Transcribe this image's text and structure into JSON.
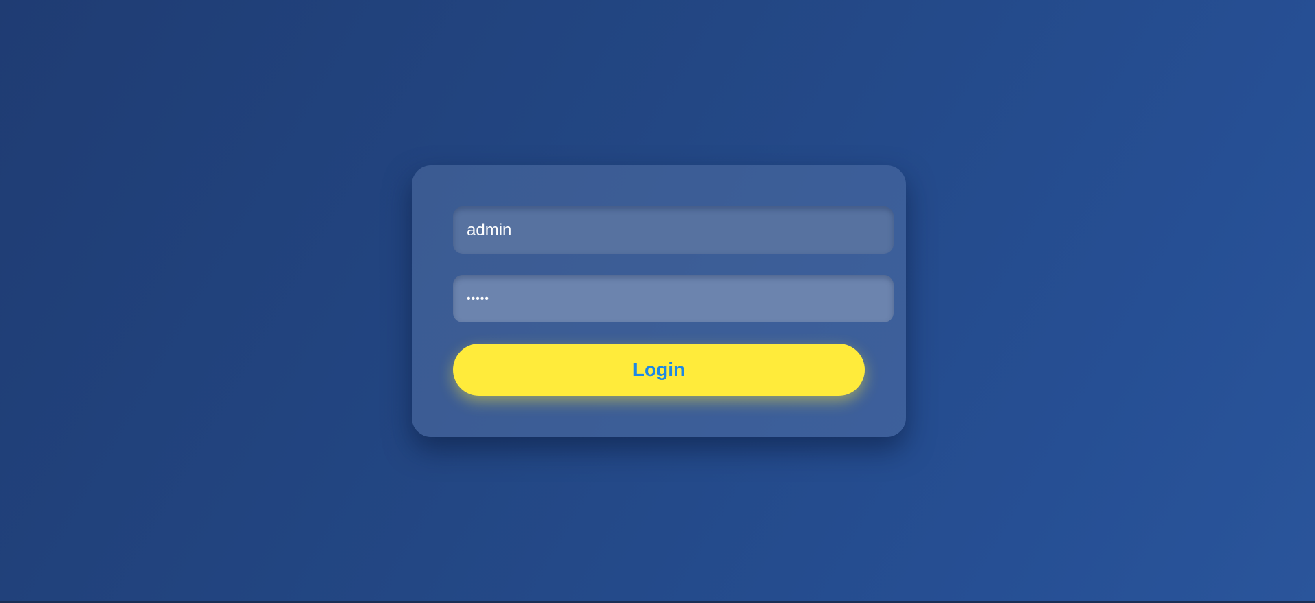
{
  "login_form": {
    "username_value": "admin",
    "password_value": "•••••",
    "login_label": "Login"
  },
  "colors": {
    "button_bg": "#ffeb3b",
    "button_text": "#1e88e5",
    "background": "#234784"
  }
}
